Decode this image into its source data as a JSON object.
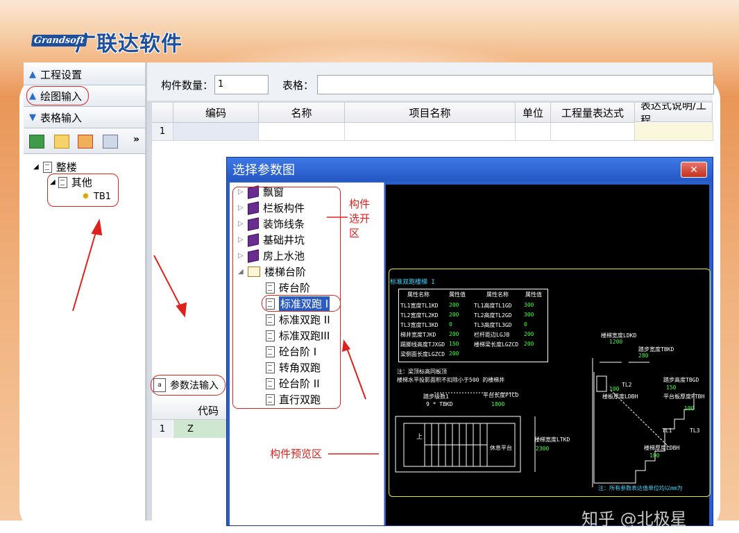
{
  "logo": {
    "en": "Grandsoft",
    "cn": "广联达软件"
  },
  "left_nav": {
    "project_settings": "工程设置",
    "drawing_input": "绘图输入",
    "table_input": "表格输入",
    "more": "»"
  },
  "tree": {
    "root": "整楼",
    "child": "其他",
    "leaf": "TB1"
  },
  "top_form": {
    "qty_label": "构件数量：",
    "qty_value": "1",
    "table_label": "表格："
  },
  "grid": {
    "columns": [
      "编码",
      "名称",
      "项目名称",
      "单位",
      "工程量表达式",
      "表达式说明/工程"
    ],
    "rows": [
      {
        "num": "1"
      }
    ]
  },
  "param_panel": {
    "button": "参数法输入",
    "column": "代码",
    "row_num": "1",
    "row_code": "Z"
  },
  "dialog": {
    "title": "选择参数图",
    "close": "✕",
    "categories": [
      "飘窗",
      "栏板构件",
      "装饰线条",
      "基础井坑",
      "房上水池",
      "楼梯台阶"
    ],
    "stairs_items": [
      "砖台阶",
      "标准双跑 I",
      "标准双跑 II",
      "标准双跑III",
      "砼台阶 I",
      "转角双跑",
      "砼台阶 II",
      "直行双跑"
    ],
    "selected": "标准双跑 I"
  },
  "annotations": {
    "component_select_line1": "构件",
    "component_select_line2": "选开",
    "component_select_line3": "区",
    "preview_area": "构件预览区"
  },
  "cad": {
    "title": "标准双跑楼梯 I",
    "table_headers": [
      "属性名称",
      "属性值",
      "属性名称",
      "属性值"
    ],
    "table_rows": [
      [
        "TL1宽度TL1KD",
        "200",
        "TL1高度TL1GD",
        "300"
      ],
      [
        "TL2宽度TL2KD",
        "200",
        "TL2高度TL2GD",
        "300"
      ],
      [
        "TL3宽度TL3KD",
        "0",
        "TL3高度TL3GD",
        "0"
      ],
      [
        "梯井宽度TJKD",
        "200",
        "栏杆距边LGJB",
        "200"
      ],
      [
        "踢脚线高度TJXGD",
        "150",
        "楼梯梁长度LGZCD",
        "200"
      ],
      [
        "梁侧面长度LGZCD",
        "200",
        "",
        ""
      ]
    ],
    "note1": "注：梁顶标高同板顶",
    "note2": "楼梯水平投影面积不扣除小于500    的楼梯井",
    "labels": {
      "step_count": "踏步级数1",
      "step_val": "9 * TBKD",
      "platform_len": "平台长度PTCD",
      "platform_val": "1800",
      "up": "上",
      "rest_platform": "休息平台",
      "stair_width": "楼梯宽度LTKD",
      "stair_width_val": "2300",
      "stair_width2": "楼梯宽度LDKD",
      "stair_width2_val": "1200",
      "tread_width": "踏步宽度TBKD",
      "tread_width_val": "280",
      "tread_height": "踏步高度TBGD",
      "tread_height_val": "150",
      "platform_thick": "平台板厚度PTBH",
      "platform_thick_val": "100",
      "stair_thick": "楼板厚度LDBH",
      "stair_thick_val": "100",
      "stair_thick2": "楼梯厚度LDBH",
      "stair_thick2_val": "100",
      "tl1": "TL1",
      "tl2": "TL2",
      "tl3": "TL3",
      "footnote": "注：所有参数表达值单位均以mm为"
    }
  },
  "watermark": "知乎 @北极星"
}
